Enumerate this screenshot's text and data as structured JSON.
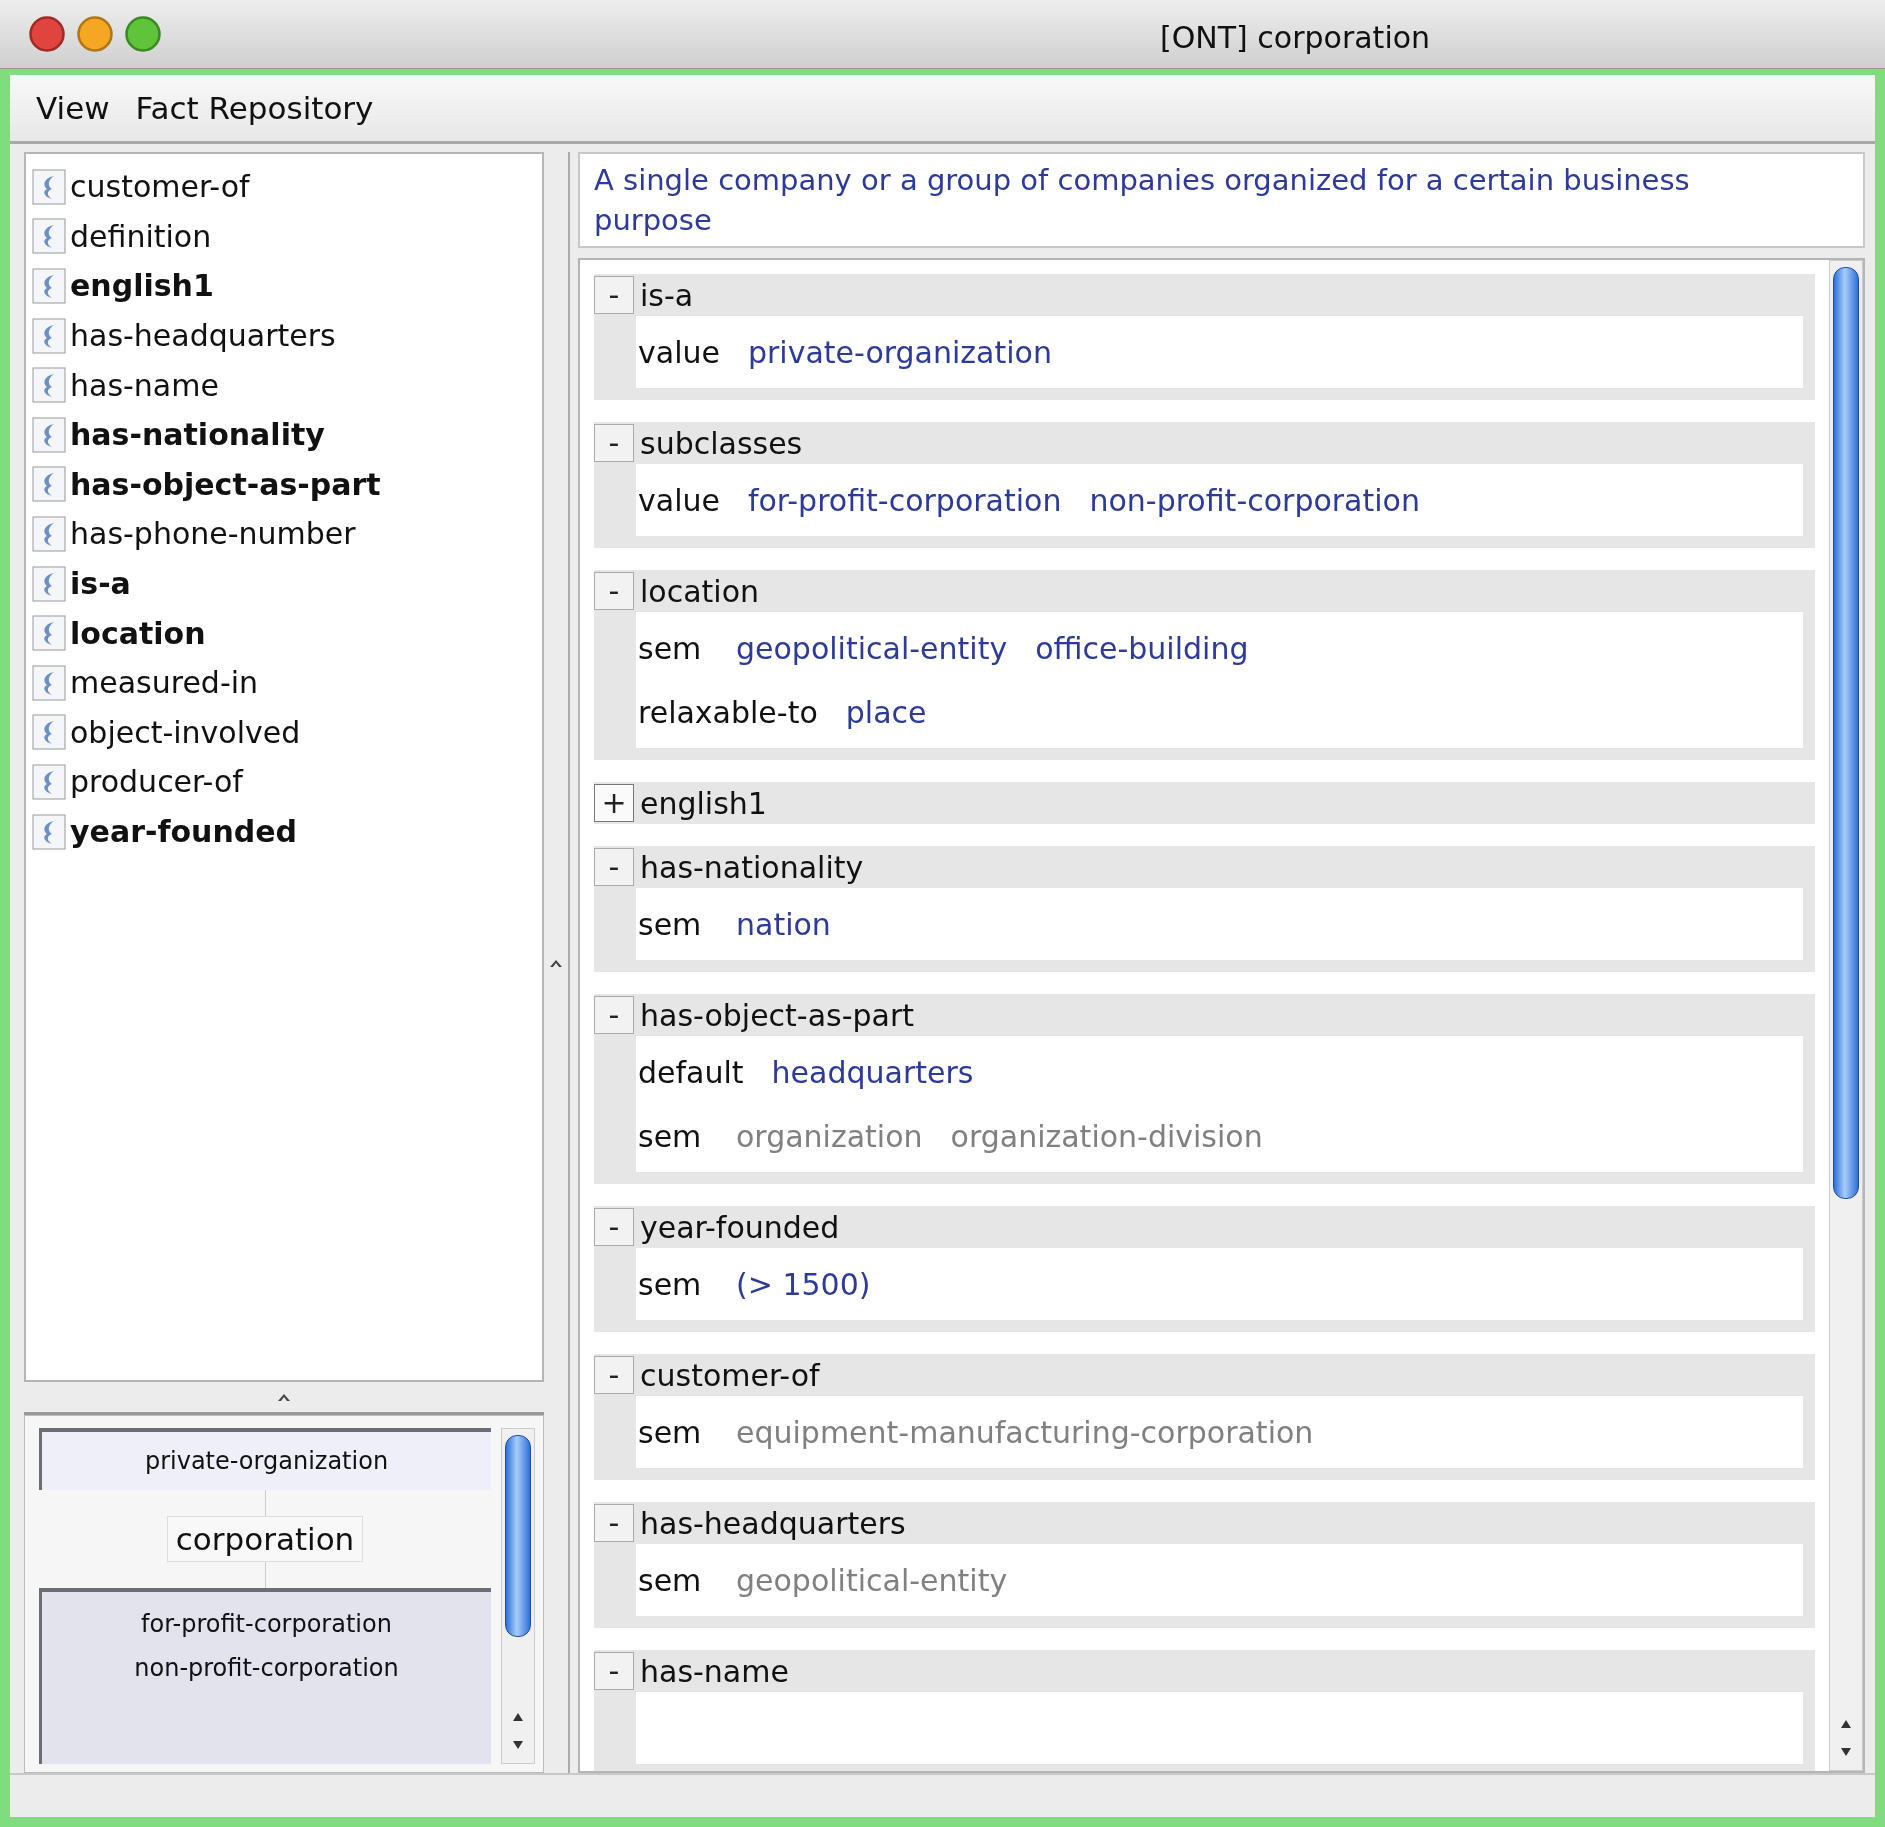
{
  "window": {
    "title": "[ONT] corporation"
  },
  "menu": [
    "View",
    "Fact Repository"
  ],
  "slot_list": [
    {
      "label": "customer-of",
      "emphasized": false
    },
    {
      "label": "definition",
      "emphasized": false
    },
    {
      "label": "english1",
      "emphasized": true
    },
    {
      "label": "has-headquarters",
      "emphasized": false
    },
    {
      "label": "has-name",
      "emphasized": false
    },
    {
      "label": "has-nationality",
      "emphasized": true
    },
    {
      "label": "has-object-as-part",
      "emphasized": true
    },
    {
      "label": "has-phone-number",
      "emphasized": false
    },
    {
      "label": "is-a",
      "emphasized": true
    },
    {
      "label": "location",
      "emphasized": true
    },
    {
      "label": "measured-in",
      "emphasized": false
    },
    {
      "label": "object-involved",
      "emphasized": false
    },
    {
      "label": "producer-of",
      "emphasized": false
    },
    {
      "label": "year-founded",
      "emphasized": true
    }
  ],
  "hierarchy": {
    "parents": [
      "private-organization"
    ],
    "current": "corporation",
    "children": [
      "for-profit-corporation",
      "non-profit-corporation"
    ]
  },
  "definition": "A single company or a group of companies organized for a certain business purpose",
  "slots": [
    {
      "name": "is-a",
      "toggle": "-",
      "expanded": true,
      "rows": [
        {
          "facet": "value",
          "values": [
            {
              "text": "private-organization",
              "inherited": false
            }
          ]
        }
      ]
    },
    {
      "name": "subclasses",
      "toggle": "-",
      "expanded": true,
      "rows": [
        {
          "facet": "value",
          "values": [
            {
              "text": "for-profit-corporation",
              "inherited": false
            },
            {
              "text": "non-profit-corporation",
              "inherited": false
            }
          ]
        }
      ]
    },
    {
      "name": "location",
      "toggle": "-",
      "expanded": true,
      "rows": [
        {
          "facet": "sem",
          "values": [
            {
              "text": "geopolitical-entity",
              "inherited": false
            },
            {
              "text": "office-building",
              "inherited": false
            }
          ]
        },
        {
          "facet": "relaxable-to",
          "values": [
            {
              "text": "place",
              "inherited": false
            }
          ]
        }
      ]
    },
    {
      "name": "english1",
      "toggle": "+",
      "expanded": false
    },
    {
      "name": "has-nationality",
      "toggle": "-",
      "expanded": true,
      "rows": [
        {
          "facet": "sem",
          "values": [
            {
              "text": "nation",
              "inherited": false
            }
          ]
        }
      ]
    },
    {
      "name": "has-object-as-part",
      "toggle": "-",
      "expanded": true,
      "rows": [
        {
          "facet": "default",
          "values": [
            {
              "text": "headquarters",
              "inherited": false
            }
          ]
        },
        {
          "facet": "sem",
          "values": [
            {
              "text": "organization",
              "inherited": true
            },
            {
              "text": "organization-division",
              "inherited": true
            }
          ]
        }
      ]
    },
    {
      "name": "year-founded",
      "toggle": "-",
      "expanded": true,
      "rows": [
        {
          "facet": "sem",
          "values": [
            {
              "text": "(> 1500)",
              "inherited": false
            }
          ]
        }
      ]
    },
    {
      "name": "customer-of",
      "toggle": "-",
      "expanded": true,
      "rows": [
        {
          "facet": "sem",
          "values": [
            {
              "text": "equipment-manufacturing-corporation",
              "inherited": true
            }
          ]
        }
      ]
    },
    {
      "name": "has-headquarters",
      "toggle": "-",
      "expanded": true,
      "rows": [
        {
          "facet": "sem",
          "values": [
            {
              "text": "geopolitical-entity",
              "inherited": true
            }
          ]
        }
      ]
    },
    {
      "name": "has-name",
      "toggle": "-",
      "expanded": true
    }
  ]
}
